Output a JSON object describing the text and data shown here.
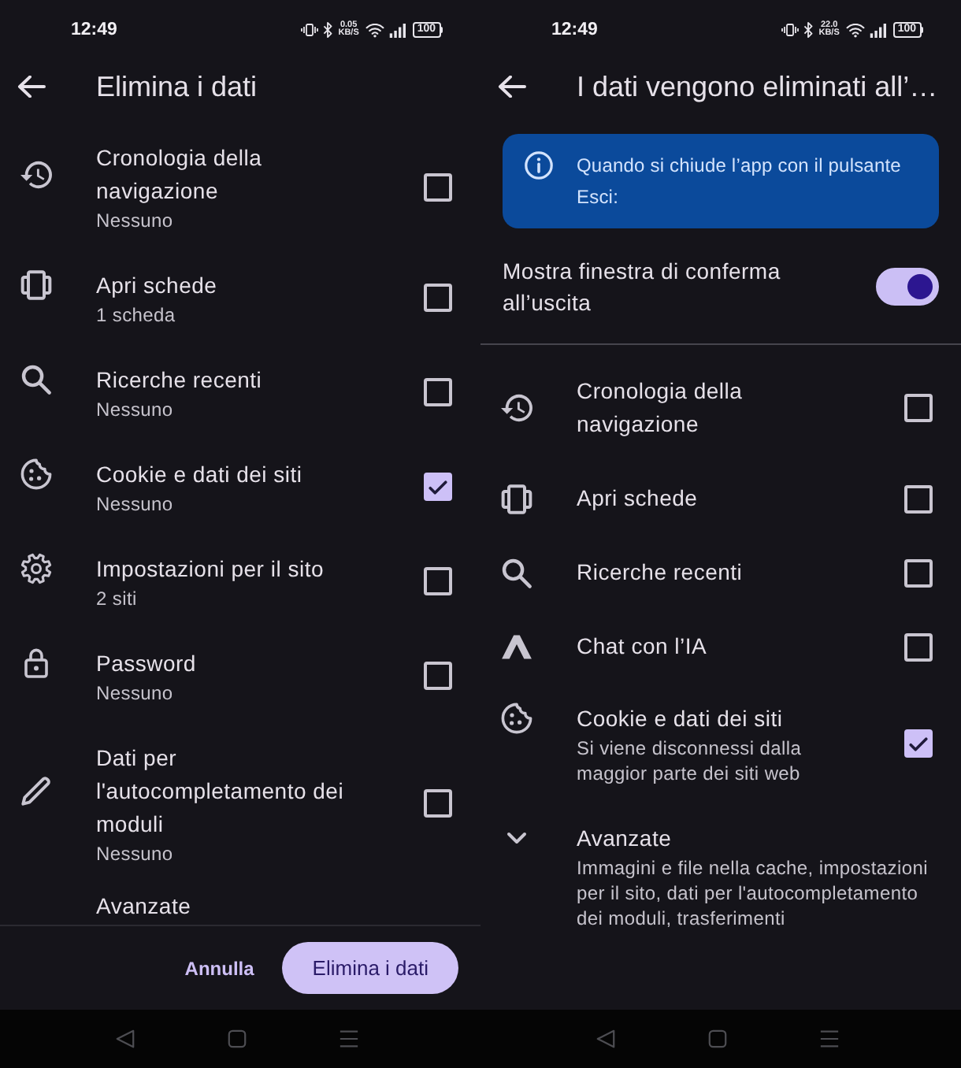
{
  "screens": [
    {
      "status_bar": {
        "time": "12:49",
        "net_speed": "0.05 KB/S",
        "battery": "100"
      },
      "header": {
        "title": "Elimina i dati"
      },
      "items": [
        {
          "kind": "history",
          "title": "Cronologia della navigazione",
          "subtitle": "Nessuno",
          "checked": false
        },
        {
          "kind": "tabs",
          "title": "Apri schede",
          "subtitle": "1 scheda",
          "checked": false
        },
        {
          "kind": "search",
          "title": "Ricerche recenti",
          "subtitle": "Nessuno",
          "checked": false
        },
        {
          "kind": "cookie",
          "title": "Cookie e dati dei siti",
          "subtitle": "Nessuno",
          "checked": true
        },
        {
          "kind": "settings",
          "title": "Impostazioni per il sito",
          "subtitle": "2 siti",
          "checked": false
        },
        {
          "kind": "password",
          "title": "Password",
          "subtitle": "Nessuno",
          "checked": false
        },
        {
          "kind": "autofill",
          "title": "Dati per l'autocompletamento dei moduli",
          "subtitle": "Nessuno",
          "checked": false
        }
      ],
      "advanced": {
        "title": "Avanzate",
        "partially_hidden": true
      },
      "footer": {
        "buttons": [
          {
            "kind": "text",
            "label": "Annulla"
          },
          {
            "kind": "filled",
            "label": "Elimina i dati"
          }
        ]
      }
    },
    {
      "status_bar": {
        "time": "12:49",
        "net_speed": "22.0 KB/S",
        "battery": "100"
      },
      "header": {
        "title": "I dati vengono eliminati all’…"
      },
      "info_banner": {
        "text": "Quando si chiude l’app con il pulsante Esci:"
      },
      "toggle": {
        "label": "Mostra finestra di conferma all’uscita",
        "on": true
      },
      "items": [
        {
          "kind": "history",
          "title": "Cronologia della navigazione",
          "checked": false
        },
        {
          "kind": "tabs",
          "title": "Apri schede",
          "checked": false
        },
        {
          "kind": "search",
          "title": "Ricerche recenti",
          "checked": false
        },
        {
          "kind": "ai",
          "title": "Chat con l’IA",
          "checked": false
        },
        {
          "kind": "cookie",
          "title": "Cookie e dati dei siti",
          "subtitle": "Si viene disconnessi dalla maggior parte dei siti web",
          "checked": true
        }
      ],
      "advanced": {
        "title": "Avanzate",
        "subtitle": "Immagini e file nella cache, impostazioni per il sito, dati per l'autocompletamento dei moduli, trasferimenti",
        "partially_hidden": false
      }
    }
  ]
}
